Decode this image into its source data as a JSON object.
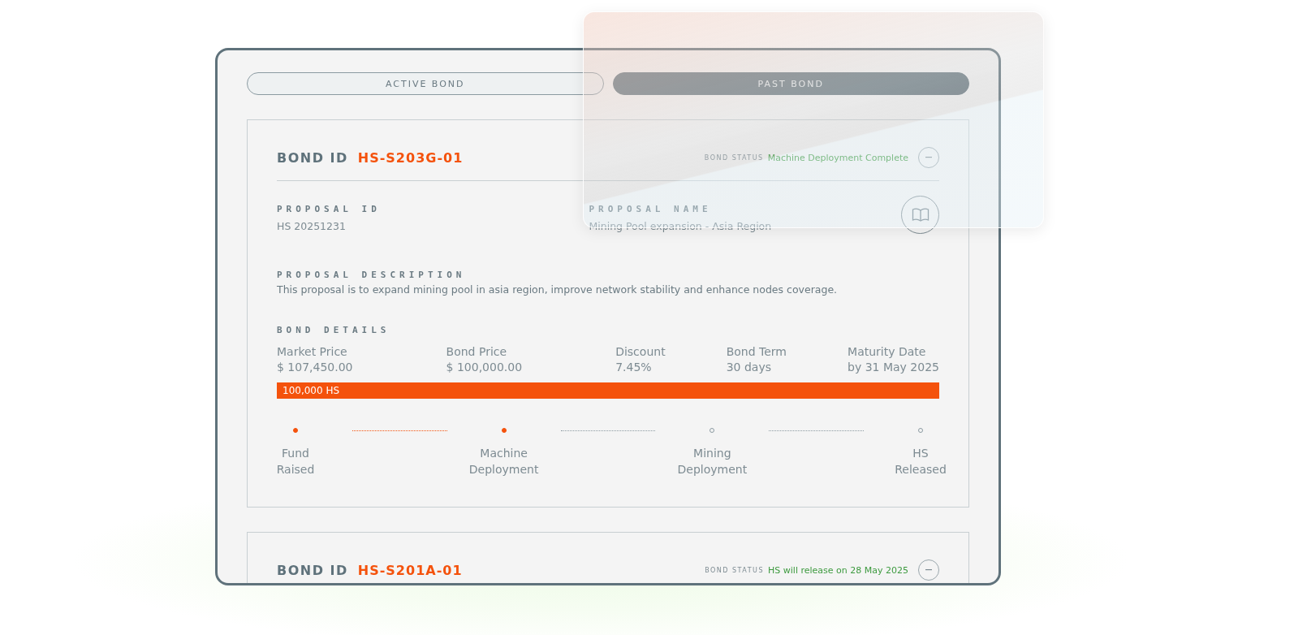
{
  "tabs": [
    {
      "label": "ACTIVE BOND",
      "selected": false
    },
    {
      "label": "PAST BOND",
      "selected": true
    }
  ],
  "bonds": [
    {
      "id_label": "BOND ID",
      "bond_id": "HS-S203G-01",
      "status_label": "BOND STATUS",
      "status": "Machine Deployment Complete",
      "expanded": true,
      "proposal_id_label": "PROPOSAL ID",
      "proposal_id": "HS 20251231",
      "proposal_name_label": "PROPOSAL NAME",
      "proposal_name": "Mining Pool expansion - Asia Region",
      "description_label": "PROPOSAL DESCRIPTION",
      "description": "This proposal is to expand mining pool in asia region, improve network stability and enhance nodes coverage.",
      "details_label": "BOND DETAILS",
      "details": [
        {
          "label": "Market Price",
          "value": "$ 107,450.00"
        },
        {
          "label": "Bond Price",
          "value": "$ 100,000.00"
        },
        {
          "label": "Discount",
          "value": "7.45%"
        },
        {
          "label": "Bond Term",
          "value": "30 days"
        },
        {
          "label": "Maturity Date",
          "value": "by 31 May 2025"
        }
      ],
      "progress": {
        "label": "100,000 HS",
        "level": 1
      },
      "steps": [
        {
          "label": "Fund Raised",
          "done": true
        },
        {
          "label": "Machine Deployment",
          "done": true
        },
        {
          "label": "Mining Deployment",
          "done": false
        },
        {
          "label": "HS Released",
          "done": false
        }
      ]
    },
    {
      "id_label": "BOND ID",
      "bond_id": "HS-S201A-01",
      "status_label": "BOND STATUS",
      "status": "HS will release on 28 May 2025",
      "expanded": true
    }
  ]
}
